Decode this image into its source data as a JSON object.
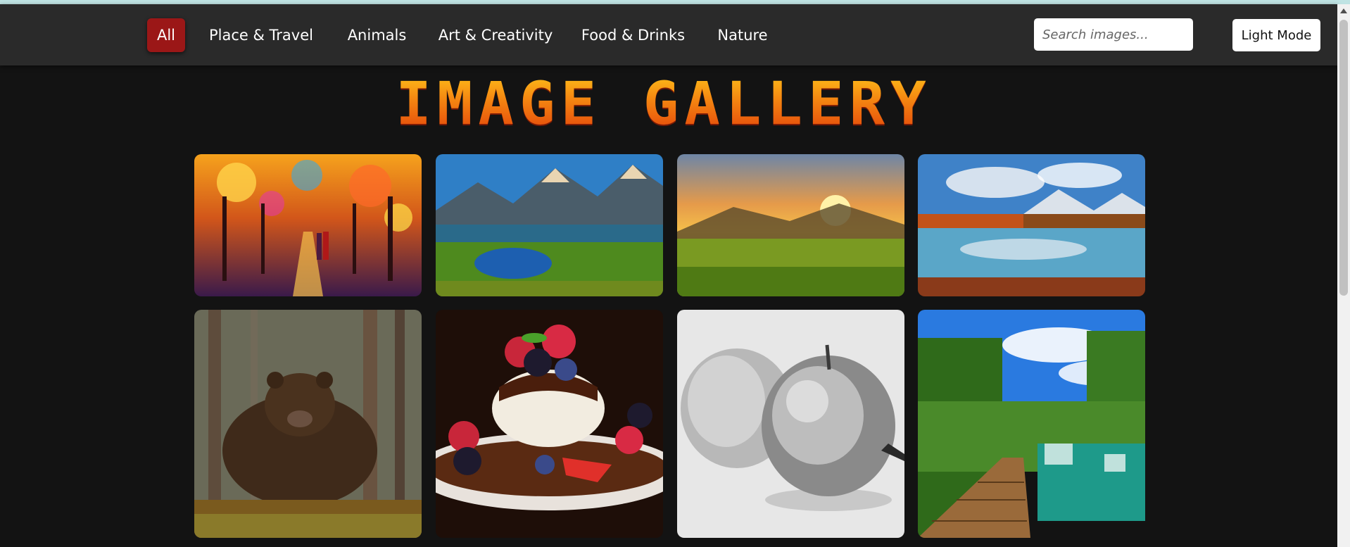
{
  "nav": {
    "categories": [
      {
        "label": "All",
        "active": true
      },
      {
        "label": "Place & Travel",
        "active": false
      },
      {
        "label": "Animals",
        "active": false
      },
      {
        "label": "Art & Creativity",
        "active": false
      },
      {
        "label": "Food & Drinks",
        "active": false
      },
      {
        "label": "Nature",
        "active": false
      }
    ],
    "search_placeholder": "Search images...",
    "mode_button_label": "Light Mode"
  },
  "title": "IMAGE GALLERY",
  "gallery": [
    {
      "subject": "impressionist painting of couple walking in colorful autumn park"
    },
    {
      "subject": "mountain lake with green meadow"
    },
    {
      "subject": "sunset over grassy hills"
    },
    {
      "subject": "alpine lake reflection under cloudy sky"
    },
    {
      "subject": "brown bear in forest"
    },
    {
      "subject": "dessert with berries and chocolate drizzle"
    },
    {
      "subject": "pencil sketch of two apples"
    },
    {
      "subject": "wooden boardwalk beside waterfall and green lake"
    }
  ],
  "colors": {
    "active_tab": "#9b1717",
    "navbar": "#2a2a2a",
    "background": "#131313",
    "title_gradient": [
      "#ffc21a",
      "#f48411",
      "#e2420a"
    ]
  }
}
